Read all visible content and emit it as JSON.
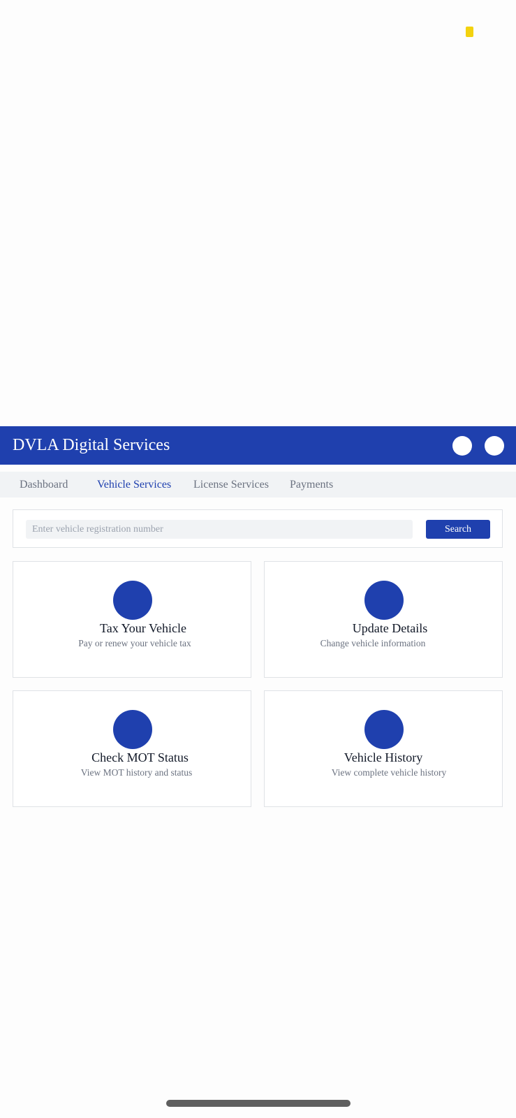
{
  "header": {
    "title": "DVLA Digital Services",
    "icons": [
      "notifications-icon",
      "profile-icon"
    ]
  },
  "nav": {
    "tabs": [
      {
        "label": "Dashboard"
      },
      {
        "label": "Vehicle Services"
      },
      {
        "label": "License Services"
      },
      {
        "label": "Payments"
      }
    ],
    "active": "Vehicle Services"
  },
  "search": {
    "placeholder": "Enter vehicle registration number",
    "value": "",
    "button_label": "Search"
  },
  "services": [
    {
      "title": "Tax Your Vehicle",
      "description": "Pay or renew your vehicle tax",
      "icon": "tax-icon"
    },
    {
      "title": "Update Details",
      "description": "Change vehicle information",
      "icon": "edit-icon"
    },
    {
      "title": "Check MOT Status",
      "description": "View MOT history and status",
      "icon": "mot-icon"
    },
    {
      "title": "Vehicle History",
      "description": "View complete vehicle history",
      "icon": "history-icon"
    }
  ],
  "colors": {
    "primary": "#1f40ae",
    "nav_background": "#f1f3f5",
    "status_indicator": "#f3d20f"
  }
}
